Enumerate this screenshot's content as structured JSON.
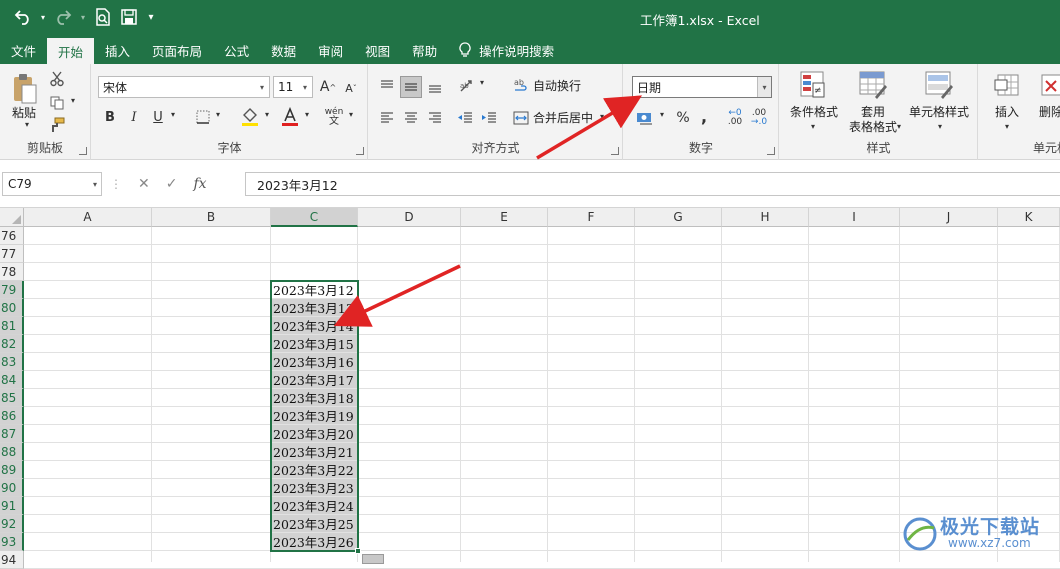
{
  "window": {
    "title": "工作簿1.xlsx  -  Excel"
  },
  "qat": {
    "more": "▾"
  },
  "tabs": [
    {
      "label": "文件",
      "active": false
    },
    {
      "label": "开始",
      "active": true
    },
    {
      "label": "插入",
      "active": false
    },
    {
      "label": "页面布局",
      "active": false
    },
    {
      "label": "公式",
      "active": false
    },
    {
      "label": "数据",
      "active": false
    },
    {
      "label": "审阅",
      "active": false
    },
    {
      "label": "视图",
      "active": false
    },
    {
      "label": "帮助",
      "active": false
    }
  ],
  "tell_me": "操作说明搜索",
  "ribbon": {
    "clipboard": {
      "paste": "粘贴",
      "label": "剪贴板"
    },
    "font": {
      "name": "宋体",
      "size": "11",
      "label": "字体",
      "bold": "B",
      "italic": "I",
      "underline": "U",
      "grow": "A",
      "shrink": "A",
      "phonetic": "wén",
      "font_color": "#e02020",
      "fill_color": "#ffe000"
    },
    "alignment": {
      "wrap": "自动换行",
      "merge": "合并后居中",
      "label": "对齐方式"
    },
    "number": {
      "format": "日期",
      "percent": "%",
      "comma": ",",
      "inc_dec": ".00",
      "label": "数字"
    },
    "styles": {
      "cond": "条件格式",
      "table1": "套用",
      "table2": "表格格式",
      "cell": "单元格样式",
      "label": "样式"
    },
    "cells": {
      "insert": "插入",
      "delete": "删除",
      "label": "单元格"
    }
  },
  "formula_bar": {
    "name_box": "C79",
    "cancel": "✕",
    "enter": "✓",
    "fx": "fx",
    "content": "2023年3月12"
  },
  "columns": [
    "A",
    "B",
    "C",
    "D",
    "E",
    "F",
    "G",
    "H",
    "I",
    "J",
    "K"
  ],
  "rows": [
    "76",
    "77",
    "78",
    "79",
    "80",
    "81",
    "82",
    "83",
    "84",
    "85",
    "86",
    "87",
    "88",
    "89",
    "90",
    "91",
    "92",
    "93",
    "94"
  ],
  "selected_column": "C",
  "cells_c": [
    "2023年3月12",
    "2023年3月13",
    "2023年3月14",
    "2023年3月15",
    "2023年3月16",
    "2023年3月17",
    "2023年3月18",
    "2023年3月19",
    "2023年3月20",
    "2023年3月21",
    "2023年3月22",
    "2023年3月23",
    "2023年3月24",
    "2023年3月25",
    "2023年3月26"
  ],
  "watermark": {
    "brand": "极光下载站",
    "url": "www.xz7.com"
  },
  "colors": {
    "excel_green": "#217346",
    "arrow_red": "#e02424"
  }
}
